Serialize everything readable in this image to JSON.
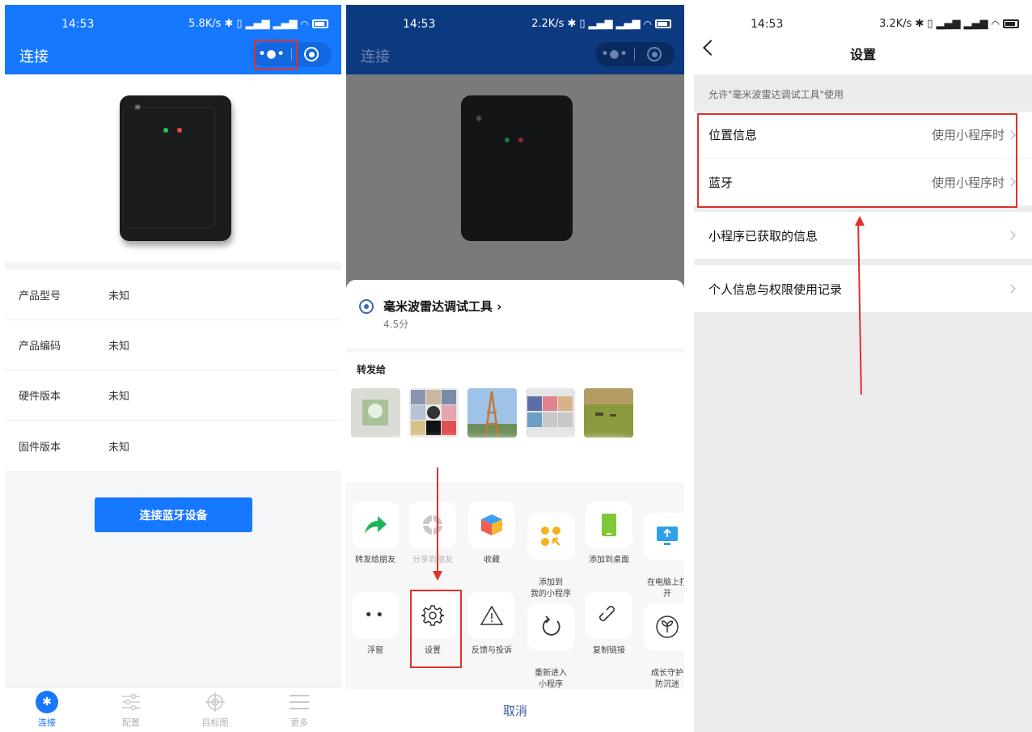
{
  "panel1": {
    "status_time": "14:53",
    "status_speed": "5.8K/s",
    "title": "连接",
    "device_info": [
      {
        "label": "产品型号",
        "value": "未知"
      },
      {
        "label": "产品编码",
        "value": "未知"
      },
      {
        "label": "硬件版本",
        "value": "未知"
      },
      {
        "label": "固件版本",
        "value": "未知"
      }
    ],
    "connect_button": "连接蓝牙设备",
    "tabs": [
      "连接",
      "配置",
      "目标图",
      "更多"
    ],
    "accent_color": "#1677ff",
    "annotation_color": "#e0312b"
  },
  "panel2": {
    "status_time": "14:53",
    "status_speed": "2.2K/s",
    "title": "连接",
    "app_name": "毫米波雷达调试工具 ›",
    "app_score": "4.5分",
    "forward_label": "转发给",
    "row1": [
      "转发给朋友",
      "分享到朋友",
      "收藏",
      "添加到\n我的小程序",
      "添加到桌面",
      "在电脑上打\n开"
    ],
    "row2": [
      "浮窗",
      "设置",
      "反馈与投诉",
      "重新进入\n小程序",
      "复制链接",
      "成长守护\n防沉迷"
    ],
    "cancel": "取消"
  },
  "panel3": {
    "status_time": "14:53",
    "status_speed": "3.2K/s",
    "title": "设置",
    "allow_text": "允许\"毫米波雷达调试工具\"使用",
    "rows": [
      {
        "label": "位置信息",
        "value": "使用小程序时"
      },
      {
        "label": "蓝牙",
        "value": "使用小程序时"
      },
      {
        "label": "小程序已获取的信息",
        "value": ""
      },
      {
        "label": "个人信息与权限使用记录",
        "value": ""
      }
    ]
  }
}
